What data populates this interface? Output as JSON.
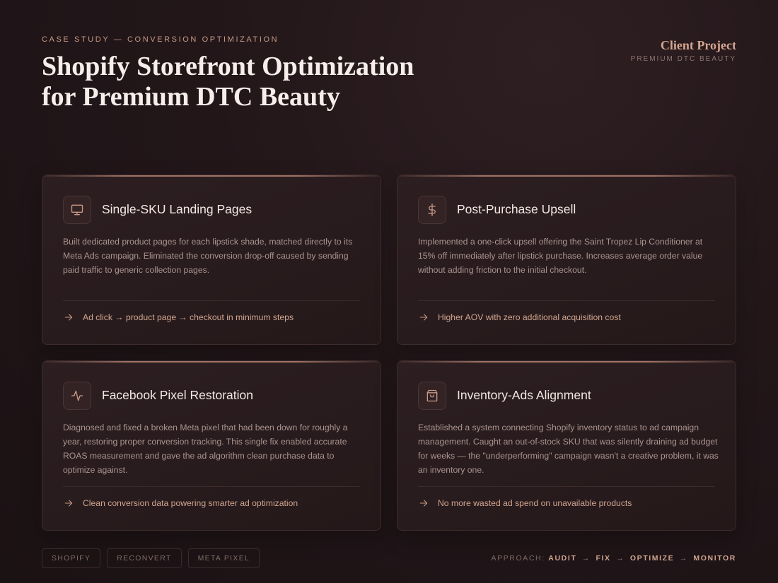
{
  "header": {
    "eyebrow": "CASE STUDY — CONVERSION OPTIMIZATION",
    "title_line1": "Shopify Storefront Optimization",
    "title_line2": "for Premium DTC Beauty"
  },
  "client": {
    "label": "Client Project",
    "sub": "PREMIUM DTC BEAUTY"
  },
  "cards": [
    {
      "icon": "monitor-icon",
      "title": "Single-SKU Landing Pages",
      "body": "Built dedicated product pages for each lipstick shade, matched directly to its Meta Ads campaign. Eliminated the conversion drop-off caused by sending paid traffic to generic collection pages.",
      "outcome": "Ad click → product page → checkout in minimum steps"
    },
    {
      "icon": "dollar-icon",
      "title": "Post-Purchase Upsell",
      "body": "Implemented a one-click upsell offering the Saint Tropez Lip Conditioner at 15% off immediately after lipstick purchase. Increases average order value without adding friction to the initial checkout.",
      "outcome": "Higher AOV with zero additional acquisition cost"
    },
    {
      "icon": "activity-icon",
      "title": "Facebook Pixel Restoration",
      "body": "Diagnosed and fixed a broken Meta pixel that had been down for roughly a year, restoring proper conversion tracking. This single fix enabled accurate ROAS measurement and gave the ad algorithm clean purchase data to optimize against.",
      "outcome": "Clean conversion data powering smarter ad optimization"
    },
    {
      "icon": "shopping-bag-icon",
      "title": "Inventory-Ads Alignment",
      "body": "Established a system connecting Shopify inventory status to ad campaign management. Caught an out-of-stock SKU that was silently draining ad budget for weeks — the \"underperforming\" campaign wasn't a creative problem, it was an inventory one.",
      "outcome": "No more wasted ad spend on unavailable products"
    }
  ],
  "tags": [
    "SHOPIFY",
    "RECONVERT",
    "META PIXEL"
  ],
  "approach": {
    "label": "APPROACH:",
    "steps": [
      "AUDIT",
      "FIX",
      "OPTIMIZE",
      "MONITOR"
    ],
    "arrow": "→"
  },
  "colors": {
    "accent": "#c79a86",
    "background": "#221619",
    "card": "#2a1d1f"
  }
}
